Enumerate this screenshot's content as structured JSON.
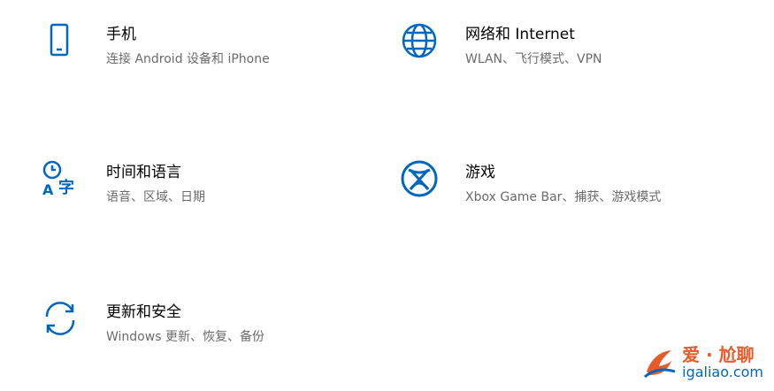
{
  "tiles": {
    "phone": {
      "title": "手机",
      "desc": "连接 Android 设备和 iPhone",
      "icon": "phone-icon"
    },
    "network": {
      "title": "网络和 Internet",
      "desc": "WLAN、飞行模式、VPN",
      "icon": "globe-icon"
    },
    "time": {
      "title": "时间和语言",
      "desc": "语音、区域、日期",
      "icon": "time-language-icon"
    },
    "gaming": {
      "title": "游戏",
      "desc": "Xbox Game Bar、捕获、游戏模式",
      "icon": "xbox-icon"
    },
    "update": {
      "title": "更新和安全",
      "desc": "Windows 更新、恢复、备份",
      "icon": "sync-icon"
    }
  },
  "watermark": {
    "top": "爱 · 尬聊",
    "bottom": "igaliao.com"
  },
  "colors": {
    "accent": "#0067c0",
    "desc_text": "#6b6b6b",
    "watermark_orange": "#e85a2a"
  }
}
